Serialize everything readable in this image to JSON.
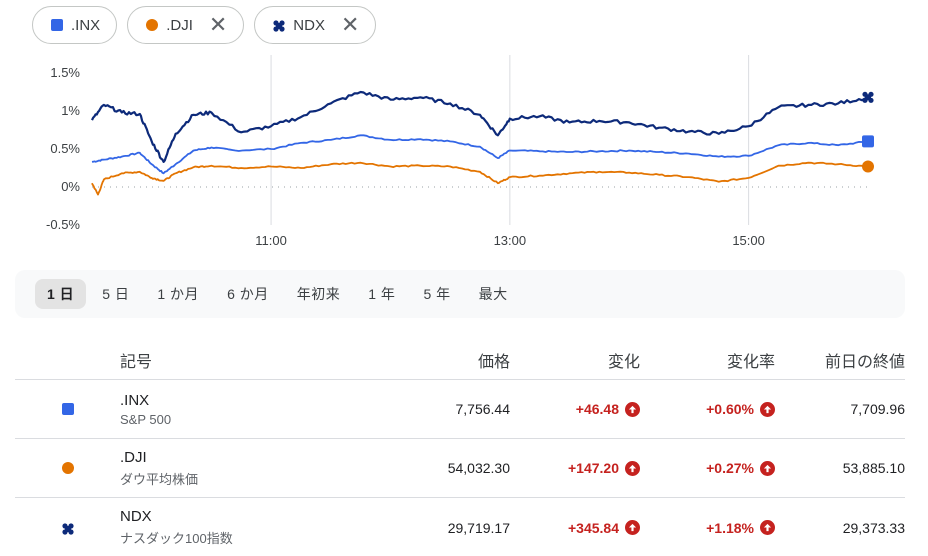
{
  "chips": [
    {
      "symbol": ".INX",
      "marker": "square",
      "color": "#3366e6",
      "closable": false
    },
    {
      "symbol": ".DJI",
      "marker": "circle",
      "color": "#e37400",
      "closable": true
    },
    {
      "symbol": "NDX",
      "marker": "cross",
      "color": "#0d2a7a",
      "closable": true
    }
  ],
  "close_glyph": "✕",
  "range_options": [
    "1 日",
    "5 日",
    "1 か月",
    "6 か月",
    "年初来",
    "1 年",
    "5 年",
    "最大"
  ],
  "range_active": 0,
  "table": {
    "headers": {
      "symbol": "記号",
      "price": "価格",
      "change": "変化",
      "change_pct": "変化率",
      "prev_close": "前日の終値"
    },
    "rows": [
      {
        "symbol": ".INX",
        "name": "S&P 500",
        "price": "7,756.44",
        "change": "+46.48",
        "change_pct": "+0.60%",
        "prev_close": "7,709.96",
        "marker": "square",
        "color": "#3366e6"
      },
      {
        "symbol": ".DJI",
        "name": "ダウ平均株価",
        "price": "54,032.30",
        "change": "+147.20",
        "change_pct": "+0.27%",
        "prev_close": "53,885.10",
        "marker": "circle",
        "color": "#e37400"
      },
      {
        "symbol": "NDX",
        "name": "ナスダック100指数",
        "price": "29,719.17",
        "change": "+345.84",
        "change_pct": "+1.18%",
        "prev_close": "29,373.33",
        "marker": "cross",
        "color": "#0d2a7a"
      }
    ]
  },
  "chart_data": {
    "type": "line",
    "x_ticks": [
      "11:00",
      "13:00",
      "15:00"
    ],
    "y_ticks": [
      "1.5%",
      "1%",
      "0.5%",
      "0%",
      "-0.5%"
    ],
    "ylim": [
      -0.5,
      1.5
    ],
    "x_range_hours": [
      9.5,
      16.0
    ],
    "grid": "vertical",
    "baseline": "0% dotted",
    "series": [
      {
        "name": ".INX",
        "color": "#3366e6",
        "marker": "square",
        "points": [
          [
            9.5,
            0.33
          ],
          [
            9.6,
            0.36
          ],
          [
            9.75,
            0.4
          ],
          [
            9.9,
            0.45
          ],
          [
            10.0,
            0.3
          ],
          [
            10.1,
            0.18
          ],
          [
            10.2,
            0.3
          ],
          [
            10.35,
            0.48
          ],
          [
            10.5,
            0.52
          ],
          [
            10.7,
            0.48
          ],
          [
            11.0,
            0.5
          ],
          [
            11.25,
            0.58
          ],
          [
            11.5,
            0.62
          ],
          [
            11.75,
            0.68
          ],
          [
            12.0,
            0.62
          ],
          [
            12.25,
            0.63
          ],
          [
            12.5,
            0.6
          ],
          [
            12.75,
            0.53
          ],
          [
            12.9,
            0.38
          ],
          [
            13.0,
            0.48
          ],
          [
            13.25,
            0.47
          ],
          [
            13.5,
            0.46
          ],
          [
            13.75,
            0.47
          ],
          [
            14.0,
            0.48
          ],
          [
            14.25,
            0.46
          ],
          [
            14.5,
            0.44
          ],
          [
            14.75,
            0.4
          ],
          [
            15.0,
            0.41
          ],
          [
            15.25,
            0.55
          ],
          [
            15.5,
            0.58
          ],
          [
            15.75,
            0.55
          ],
          [
            16.0,
            0.6
          ]
        ]
      },
      {
        "name": ".DJI",
        "color": "#e37400",
        "marker": "circle",
        "points": [
          [
            9.5,
            0.05
          ],
          [
            9.55,
            -0.1
          ],
          [
            9.6,
            0.1
          ],
          [
            9.75,
            0.18
          ],
          [
            9.9,
            0.2
          ],
          [
            10.0,
            0.12
          ],
          [
            10.1,
            0.08
          ],
          [
            10.2,
            0.18
          ],
          [
            10.35,
            0.26
          ],
          [
            10.5,
            0.28
          ],
          [
            10.75,
            0.25
          ],
          [
            11.0,
            0.27
          ],
          [
            11.25,
            0.25
          ],
          [
            11.5,
            0.3
          ],
          [
            11.75,
            0.32
          ],
          [
            12.0,
            0.27
          ],
          [
            12.25,
            0.28
          ],
          [
            12.5,
            0.27
          ],
          [
            12.75,
            0.2
          ],
          [
            12.9,
            0.05
          ],
          [
            13.0,
            0.13
          ],
          [
            13.25,
            0.15
          ],
          [
            13.5,
            0.18
          ],
          [
            13.75,
            0.2
          ],
          [
            14.0,
            0.19
          ],
          [
            14.25,
            0.16
          ],
          [
            14.5,
            0.13
          ],
          [
            14.75,
            0.07
          ],
          [
            15.0,
            0.12
          ],
          [
            15.25,
            0.28
          ],
          [
            15.5,
            0.32
          ],
          [
            15.75,
            0.3
          ],
          [
            16.0,
            0.27
          ]
        ]
      },
      {
        "name": "NDX",
        "color": "#0d2a7a",
        "marker": "cross",
        "points": [
          [
            9.5,
            0.88
          ],
          [
            9.6,
            1.08
          ],
          [
            9.75,
            0.98
          ],
          [
            9.9,
            0.96
          ],
          [
            10.0,
            0.6
          ],
          [
            10.1,
            0.33
          ],
          [
            10.2,
            0.7
          ],
          [
            10.35,
            0.95
          ],
          [
            10.5,
            0.98
          ],
          [
            10.75,
            0.72
          ],
          [
            11.0,
            0.8
          ],
          [
            11.25,
            0.92
          ],
          [
            11.5,
            1.1
          ],
          [
            11.75,
            1.25
          ],
          [
            12.0,
            1.15
          ],
          [
            12.25,
            1.18
          ],
          [
            12.5,
            1.1
          ],
          [
            12.75,
            0.95
          ],
          [
            12.9,
            0.68
          ],
          [
            13.0,
            0.9
          ],
          [
            13.25,
            0.93
          ],
          [
            13.5,
            0.85
          ],
          [
            13.75,
            0.87
          ],
          [
            14.0,
            0.85
          ],
          [
            14.25,
            0.78
          ],
          [
            14.5,
            0.73
          ],
          [
            14.75,
            0.7
          ],
          [
            15.0,
            0.8
          ],
          [
            15.25,
            1.05
          ],
          [
            15.5,
            1.08
          ],
          [
            15.75,
            1.1
          ],
          [
            16.0,
            1.18
          ]
        ]
      }
    ]
  }
}
